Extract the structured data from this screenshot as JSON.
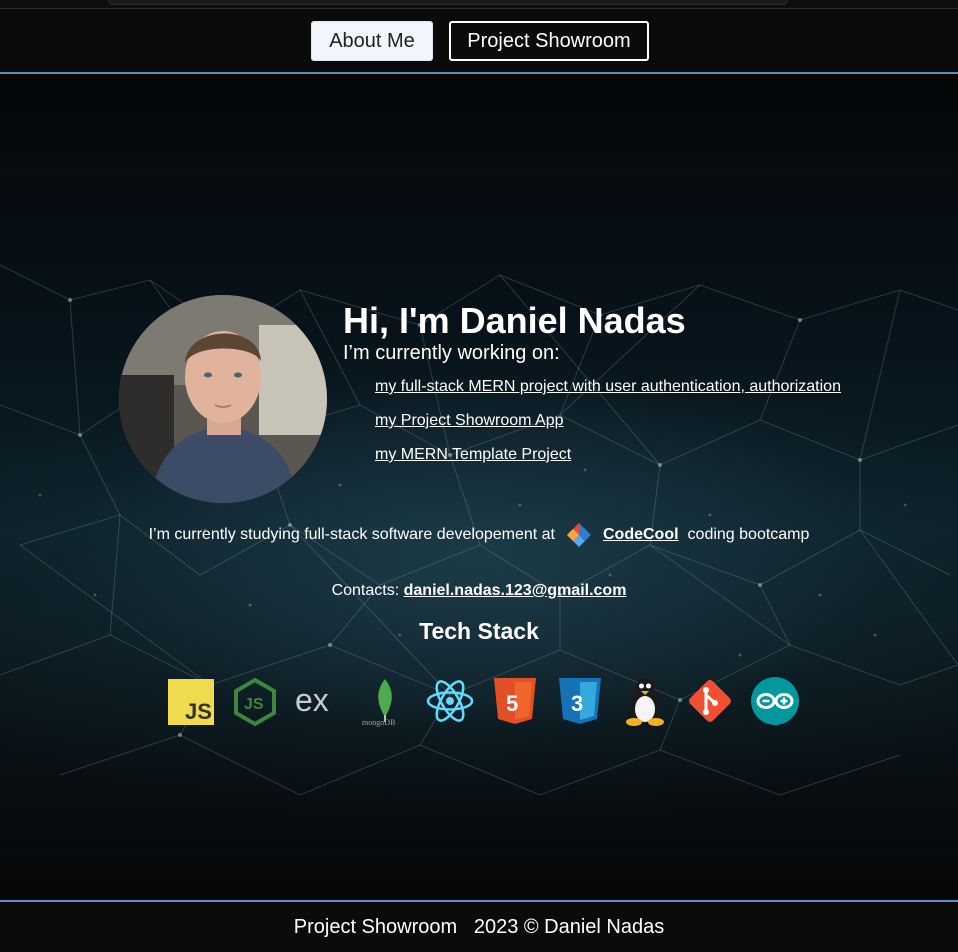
{
  "nav": {
    "about_label": "About Me",
    "showroom_label": "Project Showroom"
  },
  "hero": {
    "greeting": "Hi, I'm Daniel Nadas",
    "working_on": "I’m currently working on:",
    "projects": [
      "my full-stack MERN project with user authentication, authorization",
      "my Project Showroom App",
      "my MERN Template Project"
    ],
    "study_prefix": "I’m currently studying full-stack software developement at",
    "school_name": "CodeCool",
    "study_suffix": "coding bootcamp",
    "contacts_label": "Contacts:",
    "email": "daniel.nadas.123@gmail.com",
    "tech_stack_title": "Tech Stack",
    "tech_stack": [
      "javascript-icon",
      "nodejs-icon",
      "express-icon",
      "mongodb-icon",
      "react-icon",
      "html5-icon",
      "css3-icon",
      "linux-icon",
      "git-icon",
      "arduino-icon"
    ]
  },
  "footer": {
    "text": "Project Showroom   2023 © Daniel Nadas"
  },
  "colors": {
    "accent_border": "#5d8ec0",
    "page_bg": "#0b0b0c"
  }
}
